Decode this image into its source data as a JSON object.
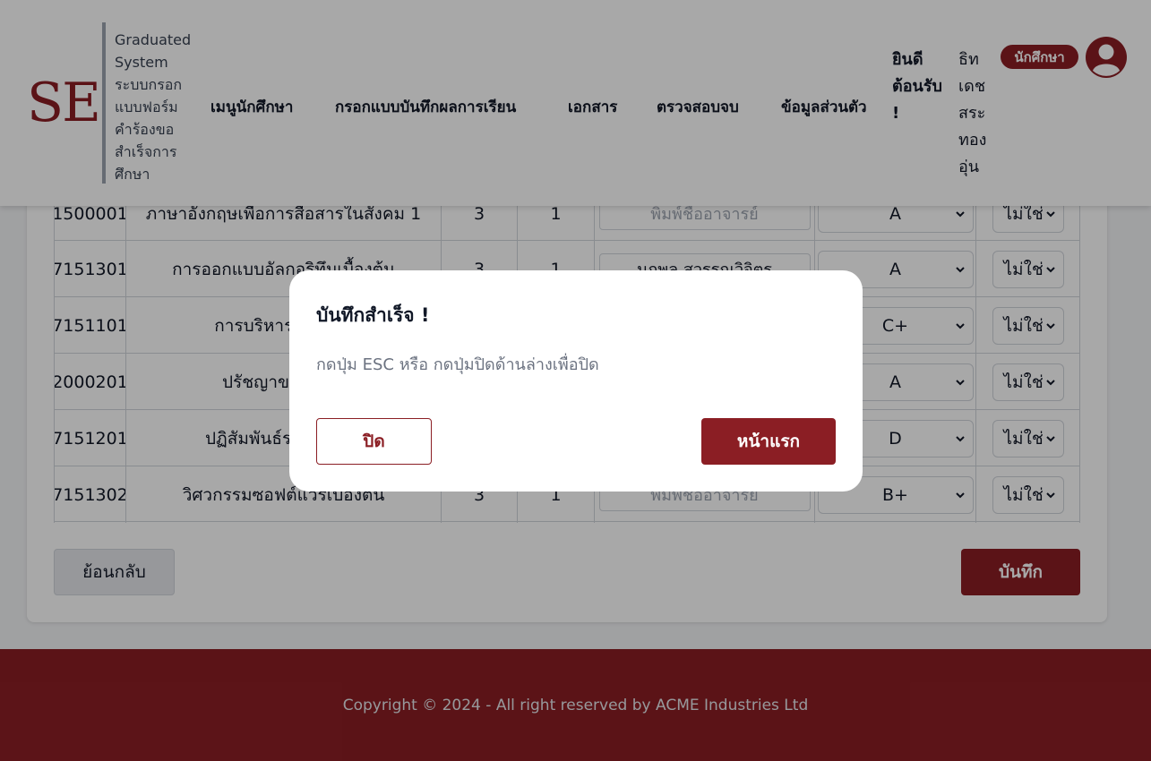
{
  "header": {
    "logo": "SE",
    "system_name": "Graduated System ระบบกรอกแบบฟอร์มคำร้องขอสำเร็จการศึกษา",
    "nav": [
      "เมนูนักศึกษา",
      "กรอกแบบบันทึกผลการเรียน",
      "เอกสาร",
      "ตรวจสอบจบ",
      "ข้อมูลส่วนตัว"
    ],
    "welcome": "ยินดีต้อนรับ !",
    "username": "ธิทเดชสระทองอุ่น",
    "role": "นักศึกษา"
  },
  "table": {
    "rows": [
      {
        "code": "1500001",
        "name": "ภาษาอังกฤษเพื่อการสื่อสารในสังคม 1",
        "credit": "3",
        "semester": "1",
        "teacher": "พิมพ์ชื่ออาจารย์",
        "teacher_is_placeholder": true,
        "grade": "A",
        "retake": "ไม่ใช่"
      },
      {
        "code": "7151301",
        "name": "การออกแบบอัลกอริทึมเบื้องต้น",
        "credit": "3",
        "semester": "1",
        "teacher": "นฤพล สุวรรณวิจิตร",
        "teacher_is_placeholder": false,
        "grade": "A",
        "retake": "ไม่ใช่"
      },
      {
        "code": "7151101",
        "name": "การบริหารและการ",
        "credit": "",
        "semester": "",
        "teacher": "",
        "teacher_is_placeholder": false,
        "grade": "C+",
        "retake": "ไม่ใช่"
      },
      {
        "code": "2000201",
        "name": "ปรัชญาของเศรษ",
        "credit": "",
        "semester": "",
        "teacher": "",
        "teacher_is_placeholder": false,
        "grade": "A",
        "retake": "ไม่ใช่"
      },
      {
        "code": "7151201",
        "name": "ปฏิสัมพันธ์ระหว่างมน",
        "credit": "",
        "semester": "",
        "teacher": "",
        "teacher_is_placeholder": false,
        "grade": "D",
        "retake": "ไม่ใช่"
      },
      {
        "code": "7151302",
        "name": "วิศวกรรมซอฟต์แวร์เบื้องต้น",
        "credit": "3",
        "semester": "1",
        "teacher": "พิมพ์ชื่ออาจารย์",
        "teacher_is_placeholder": true,
        "grade": "B+",
        "retake": "ไม่ใช่"
      }
    ]
  },
  "actions": {
    "back": "ย้อนกลับ",
    "save": "บันทึก"
  },
  "footer": {
    "copyright": "Copyright © 2024 - All right reserved by ACME Industries Ltd"
  },
  "modal": {
    "title": "บันทึกสำเร็จ !",
    "message": "กดปุ่ม ESC หรือ กดปุ่มปิดด้านล่างเพื่อปิด",
    "close_label": "ปิด",
    "home_label": "หน้าแรก"
  },
  "colors": {
    "brand": "#8b1e24",
    "overlay": "rgba(0,0,0,0.34)"
  }
}
